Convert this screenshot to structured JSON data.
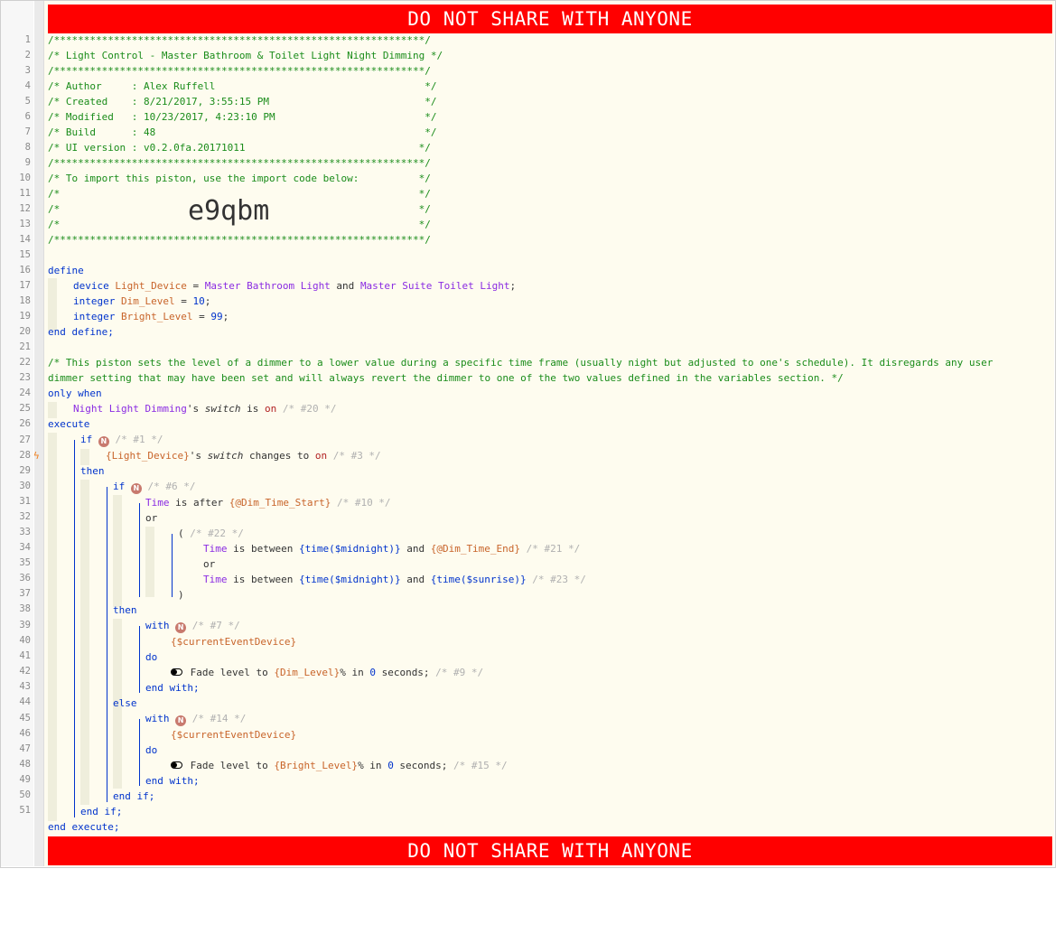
{
  "banner": {
    "text": "DO NOT SHARE WITH ANYONE"
  },
  "line_numbers": [
    "1",
    "2",
    "3",
    "4",
    "5",
    "6",
    "7",
    "8",
    "9",
    "10",
    "11",
    "12",
    "13",
    "14",
    "15",
    "16",
    "17",
    "18",
    "19",
    "20",
    "21",
    "22",
    "23",
    "24",
    "25",
    "26",
    "27",
    "28",
    "29",
    "30",
    "31",
    "32",
    "33",
    "34",
    "35",
    "36",
    "37",
    "38",
    "39",
    "40",
    "41",
    "42",
    "43",
    "44",
    "45",
    "46",
    "47",
    "48",
    "49",
    "50",
    "51"
  ],
  "header": {
    "rule": "/**************************************************************/",
    "title": "/* Light Control - Master Bathroom & Toilet Light Night Dimming */",
    "author": "/* Author     : Alex Ruffell                                   */",
    "created": "/* Created    : 8/21/2017, 3:55:15 PM                          */",
    "modified": "/* Modified   : 10/23/2017, 4:23:10 PM                         */",
    "build": "/* Build      : 48                                             */",
    "ui_version": "/* UI version : v0.2.0fa.20171011                             */",
    "import_note": "/* To import this piston, use the import code below:          */",
    "blank": "/*                                                            */",
    "import_code": "e9qbm"
  },
  "define": {
    "kw_define": "define",
    "line17": {
      "type": "device",
      "name": "Light_Device",
      "eq": " = ",
      "dev1": "Master Bathroom Light",
      "and": " and ",
      "dev2": "Master Suite Toilet Light",
      "end": ";"
    },
    "line18": {
      "type": "integer",
      "name": "Dim_Level",
      "eq": " = ",
      "val": "10",
      "end": ";"
    },
    "line19": {
      "type": "integer",
      "name": "Bright_Level",
      "eq": " = ",
      "val": "99",
      "end": ";"
    },
    "kw_end": "end define;"
  },
  "description_line1": "/* This piston sets the level of a dimmer to a lower value during a specific time frame (usually night but adjusted to one's schedule). It disregards any user",
  "description_line2": "dimmer setting that may have been set and will always revert the dimmer to one of the two values defined in the variables section. */",
  "only_when": {
    "kw": "only when",
    "device": "Night Light Dimming",
    "poss": "'s ",
    "attr": "switch",
    "is": " is ",
    "val": "on",
    "cm": " /* #20 */"
  },
  "execute": {
    "kw": "execute",
    "if1": {
      "kw": "if",
      "badge": "N",
      "cm": " /* #1 */"
    },
    "cond27": {
      "var": "{Light_Device}",
      "poss": "'s ",
      "attr": "switch",
      "op": " changes to ",
      "val": "on",
      "cm": " /* #3 */"
    },
    "then1": "then",
    "if2": {
      "kw": "if",
      "badge": "N",
      "cm": " /* #6 */"
    },
    "cond30": {
      "dev": "Time",
      "op": " is after ",
      "var": "{@Dim_Time_Start}",
      "cm": " /* #10 */"
    },
    "or31": "or",
    "group32": {
      "open": "(",
      "cm": " /* #22 */"
    },
    "cond33": {
      "dev": "Time",
      "op": " is between ",
      "expr1": "{time($midnight)}",
      "and": " and ",
      "var": "{@Dim_Time_End}",
      "cm": " /* #21 */"
    },
    "or34": "or",
    "cond35": {
      "dev": "Time",
      "op": " is between ",
      "expr1": "{time($midnight)}",
      "and": " and ",
      "expr2": "{time($sunrise)}",
      "cm": " /* #23 */"
    },
    "close36": ")",
    "then2": "then",
    "with38": {
      "kw": "with",
      "badge": "N",
      "cm": " /* #7 */"
    },
    "dev39": "{$currentEventDevice}",
    "do40": "do",
    "task41": {
      "text": "Fade level to ",
      "var": "{Dim_Level}",
      "pct": "% in ",
      "num": "0",
      "rest": " seconds;",
      "cm": " /* #9 */"
    },
    "endwith42": "end with;",
    "else43": "else",
    "with44": {
      "kw": "with",
      "badge": "N",
      "cm": " /* #14 */"
    },
    "dev45": "{$currentEventDevice}",
    "do46": "do",
    "task47": {
      "text": "Fade level to ",
      "var": "{Bright_Level}",
      "pct": "% in ",
      "num": "0",
      "rest": " seconds;",
      "cm": " /* #15 */"
    },
    "endwith48": "end with;",
    "endif49": "end if;",
    "endif50": "end if;",
    "endexec": "end execute;"
  },
  "icons": {
    "bolt": "lightning-bolt-icon",
    "toggle": "toggle-switch-icon",
    "badge": "n-badge-icon"
  },
  "colors": {
    "banner": "#ff0000",
    "comment": "#1a8c1a",
    "keyword": "#0033cc",
    "variable": "#c8642a",
    "device": "#8a2be2"
  }
}
